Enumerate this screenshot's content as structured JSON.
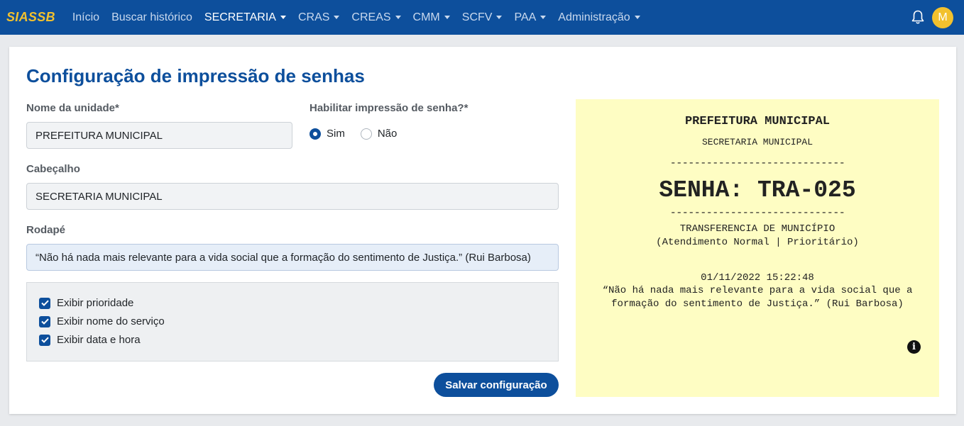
{
  "navbar": {
    "brand": "SIASSB",
    "items": [
      {
        "label": "Início",
        "dropdown": false,
        "active": false
      },
      {
        "label": "Buscar histórico",
        "dropdown": false,
        "active": false
      },
      {
        "label": "SECRETARIA",
        "dropdown": true,
        "active": true
      },
      {
        "label": "CRAS",
        "dropdown": true,
        "active": false
      },
      {
        "label": "CREAS",
        "dropdown": true,
        "active": false
      },
      {
        "label": "CMM",
        "dropdown": true,
        "active": false
      },
      {
        "label": "SCFV",
        "dropdown": true,
        "active": false
      },
      {
        "label": "PAA",
        "dropdown": true,
        "active": false
      },
      {
        "label": "Administração",
        "dropdown": true,
        "active": false
      }
    ],
    "notifications_icon": "bell-icon",
    "avatar_initial": "M"
  },
  "page": {
    "title": "Configuração de impressão de senhas"
  },
  "form": {
    "unit_name_label": "Nome da unidade*",
    "unit_name_value": "PREFEITURA MUNICIPAL",
    "enable_print_label": "Habilitar impressão de senha?*",
    "enable_print_options": [
      {
        "label": "Sim",
        "checked": true
      },
      {
        "label": "Não",
        "checked": false
      }
    ],
    "header_label": "Cabeçalho",
    "header_value": "SECRETARIA MUNICIPAL",
    "footer_label": "Rodapé",
    "footer_value": "“Não há nada mais relevante para a vida social que a formação do sentimento de Justiça.” (Rui Barbosa)",
    "checkboxes": [
      {
        "label": "Exibir prioridade",
        "checked": true
      },
      {
        "label": "Exibir nome do serviço",
        "checked": true
      },
      {
        "label": "Exibir data e hora",
        "checked": true
      }
    ],
    "save_label": "Salvar configuração"
  },
  "preview": {
    "title": "PREFEITURA MUNICIPAL",
    "subtitle": "SECRETARIA MUNICIPAL",
    "divider": "-----------------------------",
    "ticket": "SENHA: TRA-025",
    "service": "TRANSFERENCIA DE MUNICÍPIO",
    "mode": "(Atendimento Normal | Prioritário)",
    "datetime": "01/11/2022 15:22:48",
    "quote": "“Não há nada mais relevante para a vida social que a formação do sentimento de Justiça.” (Rui Barbosa)",
    "info_icon": "info-icon"
  },
  "colors": {
    "primary": "#0d4f9c",
    "brand": "#f2c12e",
    "preview_bg": "#fefdc3"
  }
}
